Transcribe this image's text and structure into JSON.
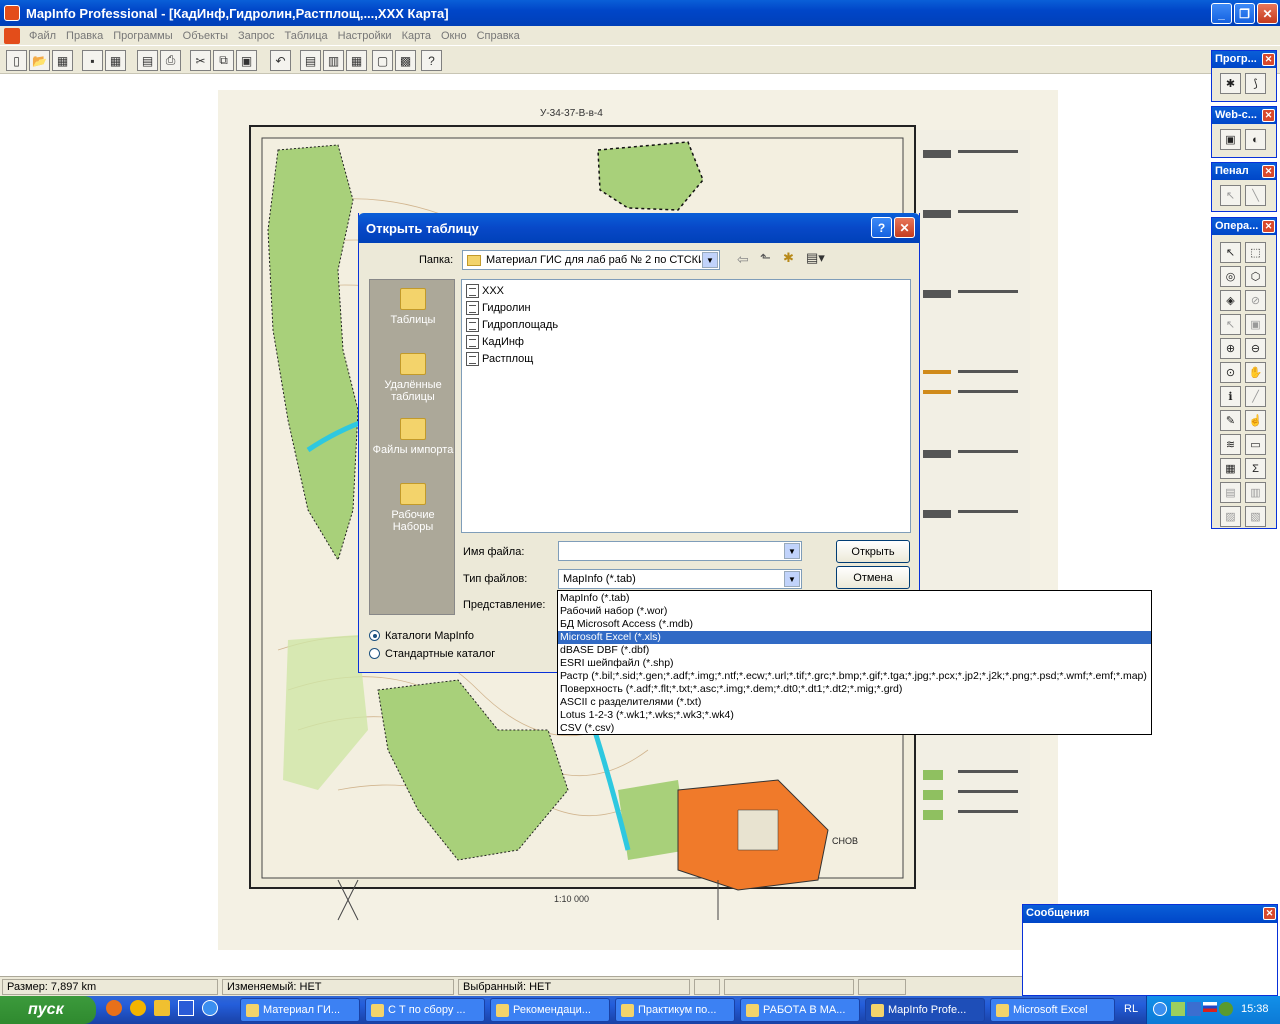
{
  "window": {
    "title": "MapInfo Professional - [КадИнф,Гидролин,Растплощ,...,XXX Карта]"
  },
  "menu": [
    "Файл",
    "Правка",
    "Программы",
    "Объекты",
    "Запрос",
    "Таблица",
    "Настройки",
    "Карта",
    "Окно",
    "Справка"
  ],
  "map": {
    "sheet_label": "У-34-37-В-в-4",
    "scale_label": "1:10 000",
    "city_label": "СНОВ"
  },
  "dialog": {
    "title": "Открыть таблицу",
    "folder_label": "Папка:",
    "folder_value": "Материал ГИС для лаб раб № 2 по СТСКИ",
    "places": [
      "Таблицы",
      "Удалённые таблицы",
      "Файлы импорта",
      "Рабочие Наборы"
    ],
    "files": [
      "XXX",
      "Гидролин",
      "Гидроплощадь",
      "КадИнф",
      "Растплощ"
    ],
    "filename_label": "Имя файла:",
    "filename_value": "",
    "filetype_label": "Тип файлов:",
    "filetype_value": "MapInfo (*.tab)",
    "view_label": "Представление:",
    "open_button": "Открыть",
    "cancel_button": "Отмена",
    "radio_mapinfo": "Каталоги MapInfo",
    "radio_standard": "Стандартные каталог"
  },
  "dropdown_options": [
    "MapInfo (*.tab)",
    "Рабочий набор (*.wor)",
    "БД Microsoft Access (*.mdb)",
    "Microsoft Excel (*.xls)",
    "dBASE DBF (*.dbf)",
    "ESRI шейпфайл (*.shp)",
    "Растр (*.bil;*.sid;*.gen;*.adf;*.img;*.ntf;*.ecw;*.url;*.tif;*.grc;*.bmp;*.gif;*.tga;*.jpg;*.pcx;*.jp2;*.j2k;*.png;*.psd;*.wmf;*.emf;*.map)",
    "Поверхность (*.adf;*.flt;*.txt;*.asc;*.img;*.dem;*.dt0;*.dt1;*.dt2;*.mig;*.grd)",
    "ASCII с разделителями (*.txt)",
    "Lotus 1-2-3 (*.wk1;*.wks;*.wk3;*.wk4)",
    "CSV (*.csv)"
  ],
  "dropdown_selected_index": 3,
  "palettes": [
    "Прогр...",
    "Web-с...",
    "Пенал",
    "Опера..."
  ],
  "messages": {
    "title": "Сообщения"
  },
  "status": {
    "size": "Размер: 7,897 km",
    "editable": "Изменяемый: НЕТ",
    "selected": "Выбранный: НЕТ"
  },
  "taskbar": {
    "start": "пуск",
    "tasks": [
      "Материал ГИ...",
      "С Т по сбору ...",
      "Рекомендаци...",
      "Практикум по...",
      "РАБОТА В МА...",
      "MapInfo Profe...",
      "Microsoft Excel"
    ],
    "active_index": 5,
    "lang": "RL",
    "clock": "15:38"
  }
}
